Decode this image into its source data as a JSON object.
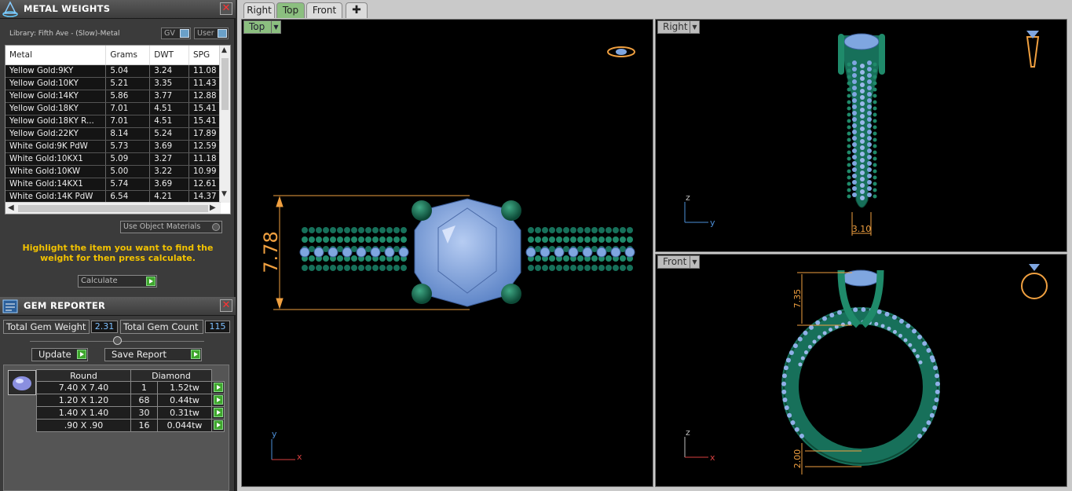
{
  "metal_weights": {
    "title": "METAL WEIGHTS",
    "library": "Library: Fifth Ave - (Slow)-Metal",
    "toggle_gv": "GV",
    "toggle_user": "User",
    "columns": [
      "Metal",
      "Grams",
      "DWT",
      "SPG"
    ],
    "rows": [
      [
        "Yellow Gold:9KY",
        "5.04",
        "3.24",
        "11.08"
      ],
      [
        "Yellow Gold:10KY",
        "5.21",
        "3.35",
        "11.43"
      ],
      [
        "Yellow Gold:14KY",
        "5.86",
        "3.77",
        "12.88"
      ],
      [
        "Yellow Gold:18KY",
        "7.01",
        "4.51",
        "15.41"
      ],
      [
        "Yellow Gold:18KY R...",
        "7.01",
        "4.51",
        "15.41"
      ],
      [
        "Yellow Gold:22KY",
        "8.14",
        "5.24",
        "17.89"
      ],
      [
        "White Gold:9K PdW",
        "5.73",
        "3.69",
        "12.59"
      ],
      [
        "White Gold:10KX1",
        "5.09",
        "3.27",
        "11.18"
      ],
      [
        "White Gold:10KW",
        "5.00",
        "3.22",
        "10.99"
      ],
      [
        "White Gold:14KX1",
        "5.74",
        "3.69",
        "12.61"
      ],
      [
        "White Gold:14K PdW",
        "6.54",
        "4.21",
        "14.37"
      ]
    ],
    "use_object_materials": "Use Object Materials",
    "hint": "Highlight the item you want to find the weight for then press calculate.",
    "calculate": "Calculate"
  },
  "gem_reporter": {
    "title": "GEM REPORTER",
    "total_weight_label": "Total Gem Weight",
    "total_weight": "2.31",
    "total_count_label": "Total Gem Count",
    "total_count": "115",
    "update": "Update",
    "save_report": "Save Report",
    "shape_header": "Round",
    "material_header": "Diamond",
    "rows": [
      [
        "7.40 X 7.40",
        "1",
        "1.52tw"
      ],
      [
        "1.20 X 1.20",
        "68",
        "0.44tw"
      ],
      [
        "1.40 X 1.40",
        "30",
        "0.31tw"
      ],
      [
        ".90 X .90",
        "16",
        "0.044tw"
      ]
    ]
  },
  "tabs": [
    "Right",
    "Top",
    "Front"
  ],
  "active_tab": "Top",
  "viewports": {
    "top": {
      "label": "Top",
      "dimension": "7.78",
      "axis_y": "y",
      "axis_x": "x"
    },
    "right": {
      "label": "Right",
      "dimension": "3.10",
      "axis_z": "z",
      "axis_y": "y"
    },
    "front": {
      "label": "Front",
      "dimension_top": "7.35",
      "dimension_bottom": "2.00",
      "axis_z": "z",
      "axis_x": "x"
    }
  },
  "colors": {
    "ring": "#17705a",
    "gem": "#7fa6e0",
    "dimension": "#f0a040",
    "accent": "#3fa62d",
    "hint": "#f2c200"
  }
}
